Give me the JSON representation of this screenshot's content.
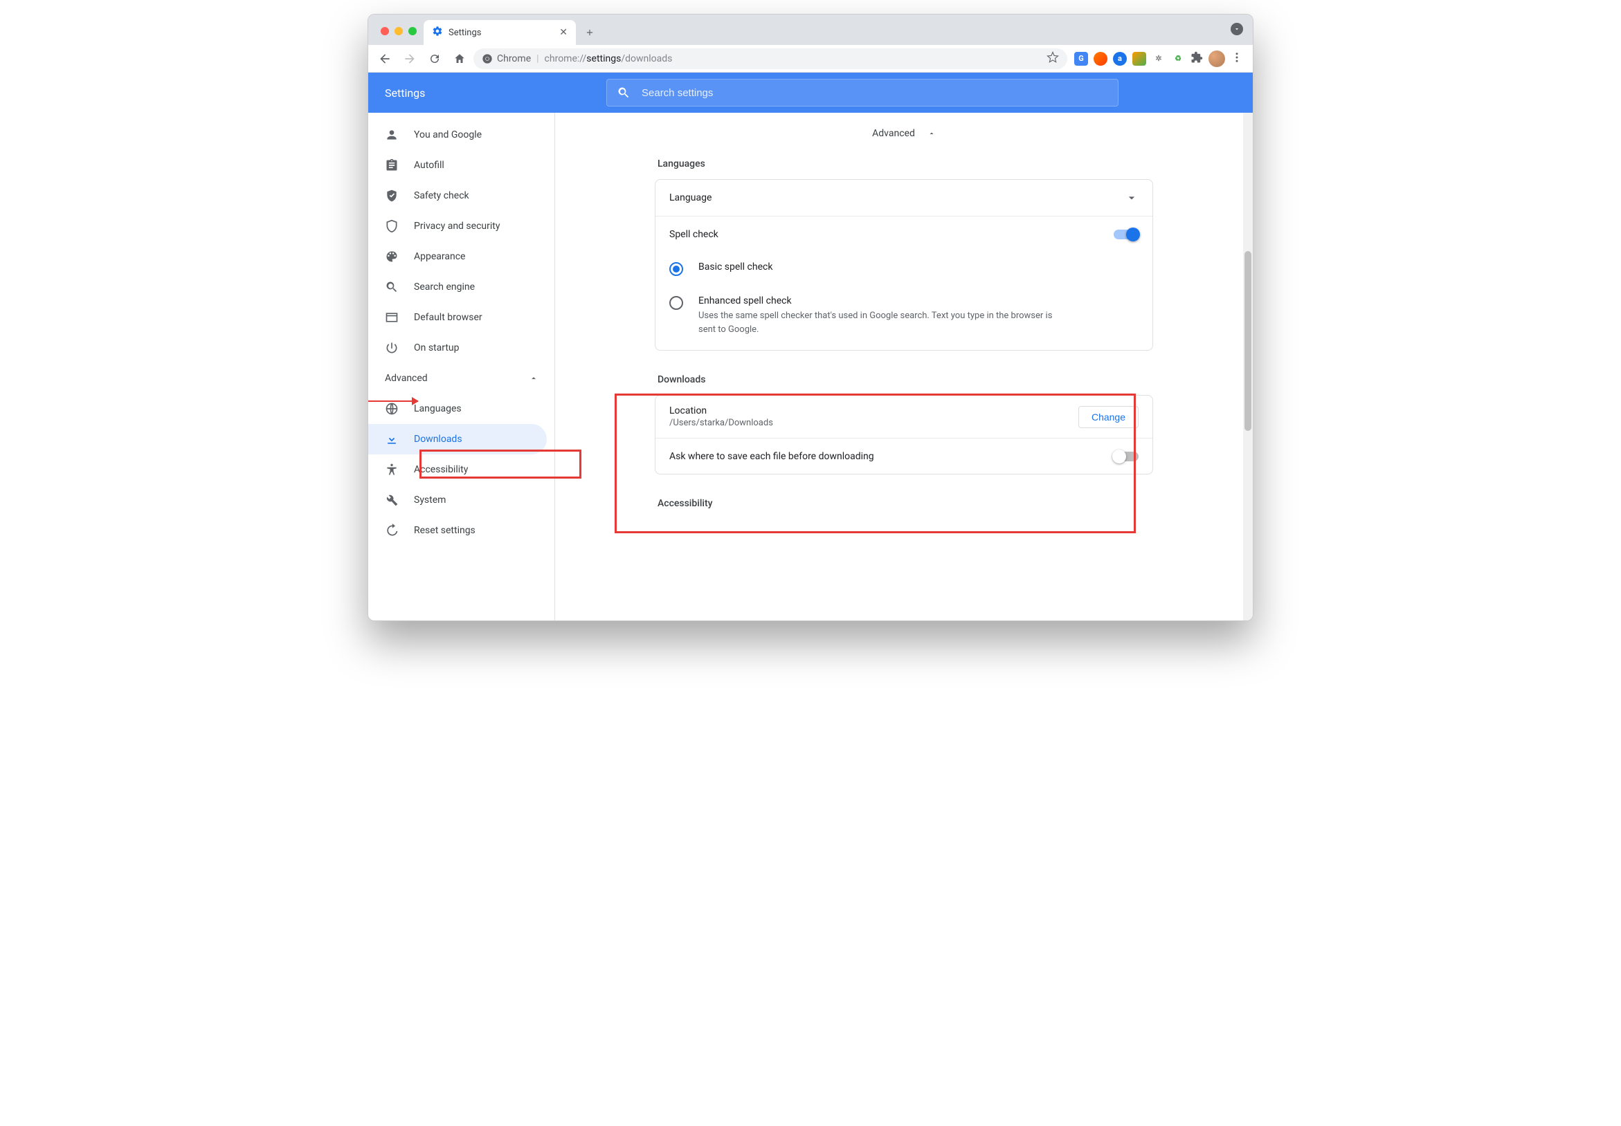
{
  "window": {
    "tab_title": "Settings",
    "url_prefix": "Chrome",
    "url_scheme": "chrome://",
    "url_bold": "settings",
    "url_rest": "/downloads"
  },
  "header": {
    "title": "Settings",
    "search_placeholder": "Search settings"
  },
  "sidebar": {
    "items": [
      {
        "label": "You and Google"
      },
      {
        "label": "Autofill"
      },
      {
        "label": "Safety check"
      },
      {
        "label": "Privacy and security"
      },
      {
        "label": "Appearance"
      },
      {
        "label": "Search engine"
      },
      {
        "label": "Default browser"
      },
      {
        "label": "On startup"
      }
    ],
    "advanced_label": "Advanced",
    "advanced_items": [
      {
        "label": "Languages"
      },
      {
        "label": "Downloads"
      },
      {
        "label": "Accessibility"
      },
      {
        "label": "System"
      },
      {
        "label": "Reset settings"
      }
    ]
  },
  "main": {
    "advanced_toggle": "Advanced",
    "languages": {
      "section_title": "Languages",
      "language_row": "Language",
      "spellcheck_label": "Spell check",
      "radio_basic": "Basic spell check",
      "radio_enhanced": "Enhanced spell check",
      "radio_enhanced_desc": "Uses the same spell checker that's used in Google search. Text you type in the browser is sent to Google."
    },
    "downloads": {
      "section_title": "Downloads",
      "location_label": "Location",
      "location_value": "/Users/starka/Downloads",
      "change_btn": "Change",
      "ask_label": "Ask where to save each file before downloading"
    },
    "accessibility": {
      "section_title": "Accessibility"
    }
  }
}
